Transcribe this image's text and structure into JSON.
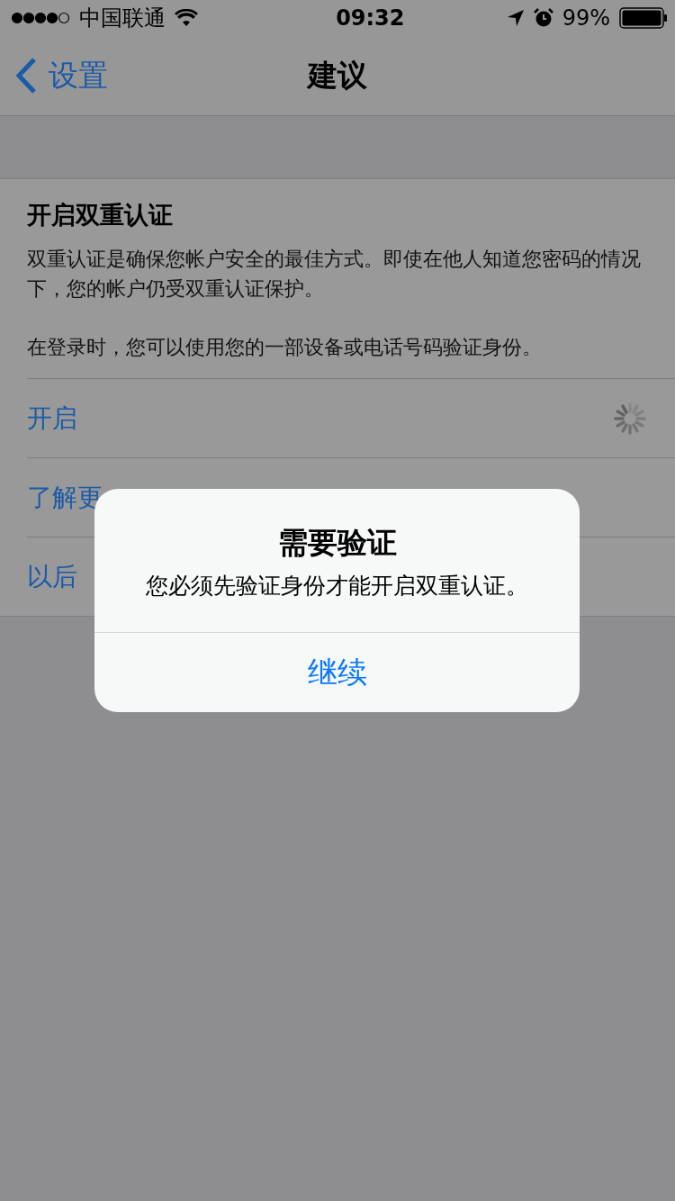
{
  "status_bar": {
    "carrier": "中国联通",
    "time": "09:32",
    "battery": "99%"
  },
  "nav": {
    "back": "设置",
    "title": "建议"
  },
  "card": {
    "title": "开启双重认证",
    "paragraphs": [
      "双重认证是确保您帐户安全的最佳方式。即使在他人知道您密码的情况下，您的帐户仍受双重认证保护。",
      "在登录时，您可以使用您的一部设备或电话号码验证身份。"
    ],
    "rows": [
      {
        "label": "开启",
        "loading": true
      },
      {
        "label": "了解更",
        "loading": false
      },
      {
        "label": "以后",
        "loading": false
      }
    ]
  },
  "alert": {
    "title": "需要验证",
    "message": "您必须先验证身份才能开启双重认证。",
    "button": "继续"
  }
}
